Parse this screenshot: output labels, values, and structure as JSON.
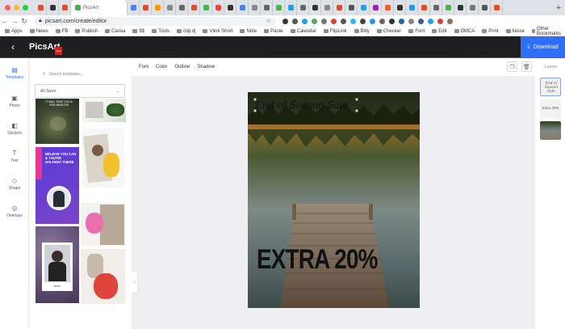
{
  "browser": {
    "active_tab_title": "PicsArt",
    "url": "picsart.com/create/editor",
    "tab_letters": [
      "P",
      "C",
      "P",
      "S",
      "C",
      "A",
      "C",
      "D",
      "D",
      "A",
      "D",
      "H",
      "D",
      "B",
      "D",
      "G",
      "G",
      "S",
      "G",
      "D",
      "A",
      "P",
      "D",
      "X",
      "B",
      "B",
      "D",
      "T",
      "A",
      "N",
      "B",
      "D",
      "B",
      "H",
      "P"
    ],
    "bookmarks": [
      {
        "label": "Apps"
      },
      {
        "label": "News"
      },
      {
        "label": "FB"
      },
      {
        "label": "Publish"
      },
      {
        "label": "Canva"
      },
      {
        "label": "$$"
      },
      {
        "label": "Tools"
      },
      {
        "label": "clip.dj"
      },
      {
        "label": "Vlink Short"
      },
      {
        "label": "Note"
      },
      {
        "label": "Paste"
      },
      {
        "label": "Calendar"
      },
      {
        "label": "FlipLink"
      },
      {
        "label": "Bitly"
      },
      {
        "label": "Checker"
      },
      {
        "label": "Font"
      },
      {
        "label": "Edit"
      },
      {
        "label": "DMCA"
      },
      {
        "label": "Print"
      },
      {
        "label": "Noise"
      }
    ],
    "other_bookmarks": "Other Bookmarks"
  },
  "app": {
    "logo": "PicsArt",
    "logo_badge": "Web",
    "download_label": "Download"
  },
  "rail": {
    "items": [
      {
        "label": "Templates",
        "icon": "templates-icon",
        "glyph": "▤"
      },
      {
        "label": "Photo",
        "icon": "photo-icon",
        "glyph": "▣"
      },
      {
        "label": "Stickers",
        "icon": "stickers-icon",
        "glyph": "◧"
      },
      {
        "label": "Text",
        "icon": "text-icon",
        "glyph": "T"
      },
      {
        "label": "Shape",
        "icon": "shape-icon",
        "glyph": "◇"
      },
      {
        "label": "Overlays",
        "icon": "overlays-icon",
        "glyph": "◎"
      }
    ]
  },
  "panel": {
    "search_placeholder": "Search templates...",
    "select_value": "All Sizes",
    "thumb1_text": "IT WILL TAKE YOU A FEW MINUTES",
    "thumb3_text": "BELIEVE YOU CAN & YOU'RE HALFWAY THERE",
    "thumb6_text": "BOOK"
  },
  "toolbar": {
    "items": [
      "Font",
      "Color",
      "Outline",
      "Shadow"
    ]
  },
  "artboard": {
    "title": "End of Season Sale",
    "subtitle": "EXTRA 20%"
  },
  "layers": {
    "title": "Layers",
    "layer1": "End of Season Sale",
    "layer2": "Extra 20%"
  },
  "colors": {
    "accent": "#2f6ff5",
    "header_bg": "#1f1f22"
  }
}
